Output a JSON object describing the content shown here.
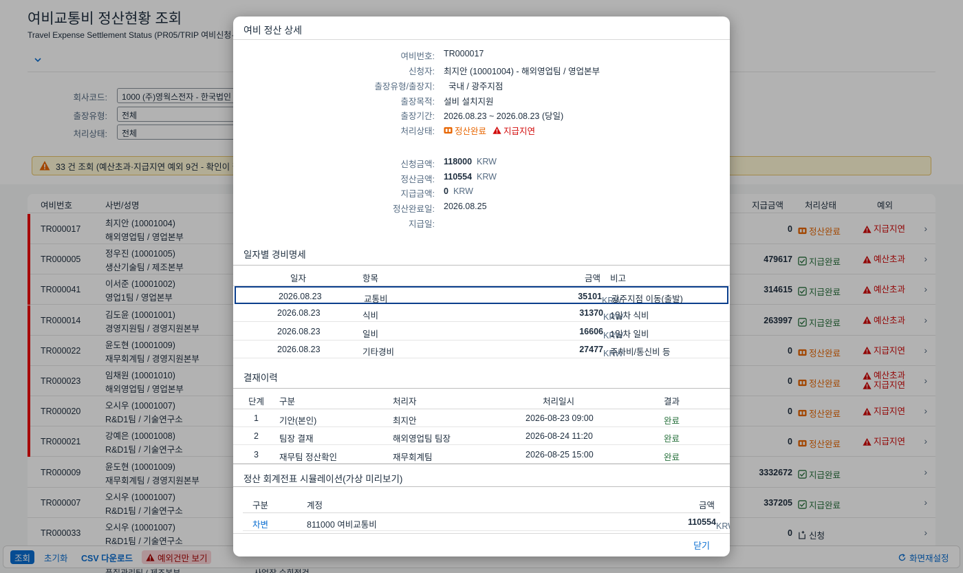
{
  "page": {
    "title": "여비교통비 정산현황 조회",
    "subtitle": "Travel Expense Settlement Status (PR05/TRIP 여비신청·정",
    "filters": [
      {
        "label": "회사코드:",
        "value": "1000 (주)영웍스전자 - 한국법인"
      },
      {
        "label": "출장유형:",
        "value": "전체"
      },
      {
        "label": "처리상태:",
        "value": "전체"
      }
    ],
    "message": "33 건 조회 (예산초과·지급지연 예외 9건 - 확인이 필"
  },
  "table": {
    "headers": {
      "id": "여비번호",
      "name": "사번/성명",
      "amount": "지급금액",
      "status": "처리상태",
      "exception": "예외"
    },
    "rows": [
      {
        "id": "TR000017",
        "name": "최지안 (10001004)",
        "dept": "해외영업팀 / 영업본부",
        "amount": "0",
        "status": "정산완료",
        "status_type": "done",
        "exceptions": [
          "지급지연"
        ],
        "flag": true
      },
      {
        "id": "TR000005",
        "name": "정우진 (10001005)",
        "dept": "생산기술팀 / 제조본부",
        "amount": "479617",
        "status": "지급완료",
        "status_type": "paid",
        "exceptions": [
          "예산초과"
        ],
        "flag": true
      },
      {
        "id": "TR000041",
        "name": "이서준 (10001002)",
        "dept": "영업1팀 / 영업본부",
        "amount": "314615",
        "status": "지급완료",
        "status_type": "paid",
        "exceptions": [
          "예산초과"
        ],
        "flag": true
      },
      {
        "id": "TR000014",
        "name": "김도윤 (10001001)",
        "dept": "경영지원팀 / 경영지원본부",
        "amount": "263997",
        "status": "지급완료",
        "status_type": "paid",
        "exceptions": [
          "예산초과"
        ],
        "flag": true
      },
      {
        "id": "TR000022",
        "name": "윤도현 (10001009)",
        "dept": "재무회계팀 / 경영지원본부",
        "amount": "0",
        "status": "정산완료",
        "status_type": "done",
        "exceptions": [
          "지급지연"
        ],
        "flag": true
      },
      {
        "id": "TR000023",
        "name": "임채원 (10001010)",
        "dept": "해외영업팀 / 영업본부",
        "amount": "0",
        "status": "정산완료",
        "status_type": "done",
        "exceptions": [
          "예산초과",
          "지급지연"
        ],
        "flag": true
      },
      {
        "id": "TR000020",
        "name": "오시우 (10001007)",
        "dept": "R&D1팀 / 기술연구소",
        "amount": "0",
        "status": "정산완료",
        "status_type": "done",
        "exceptions": [
          "지급지연"
        ],
        "flag": true
      },
      {
        "id": "TR000021",
        "name": "강예은 (10001008)",
        "dept": "R&D1팀 / 기술연구소",
        "amount": "0",
        "status": "정산완료",
        "status_type": "done",
        "exceptions": [
          "지급지연"
        ],
        "flag": true
      },
      {
        "id": "TR000009",
        "name": "윤도현 (10001009)",
        "dept": "재무회계팀 / 경영지원본부",
        "amount": "3332672",
        "status": "지급완료",
        "status_type": "paid",
        "exceptions": [],
        "flag": false
      },
      {
        "id": "TR000007",
        "name": "오시우 (10001007)",
        "dept": "R&D1팀 / 기술연구소",
        "amount": "337205",
        "status": "지급완료",
        "status_type": "paid",
        "exceptions": [],
        "flag": false
      },
      {
        "id": "TR000033",
        "name": "오시우 (10001007)",
        "dept": "R&D1팀 / 기술연구소",
        "amount": "0",
        "status": "신청",
        "status_type": "apply",
        "exceptions": [],
        "flag": false
      }
    ],
    "partial_row": {
      "dept": "품질관리팀 / 제조본부",
      "extra": "사업장 순회점검"
    }
  },
  "footer": {
    "search": "조회",
    "reset": "초기화",
    "csv": "CSV 다운로드",
    "exceptions_only": "예외건만 보기",
    "layout": "화면재설정"
  },
  "dialog": {
    "title": "여비 정산 상세",
    "fields": [
      {
        "label": "여비번호:",
        "value": "TR000017"
      },
      {
        "label": "신청자:",
        "value": "최지안 (10001004) - 해외영업팀 / 영업본부"
      },
      {
        "label": "출장유형/출장지:",
        "value": "  국내 / 광주지점"
      },
      {
        "label": "출장목적:",
        "value": "설비 설치지원"
      },
      {
        "label": "출장기간:",
        "value": "2026.08.23 ~ 2026.08.23 (당일)"
      }
    ],
    "status_label": "처리상태:",
    "status_value": "정산완료",
    "status_exception": "지급지연",
    "amounts": [
      {
        "label": "신청금액:",
        "value": "118000",
        "unit": "KRW"
      },
      {
        "label": "정산금액:",
        "value": "110554",
        "unit": "KRW"
      },
      {
        "label": "지급금액:",
        "value": "0",
        "unit": "KRW"
      }
    ],
    "settle_date_label": "정산완료일:",
    "settle_date": "2026.08.25",
    "pay_date_label": "지급일:",
    "pay_date": "",
    "daily": {
      "title": "일자별 경비명세",
      "headers": {
        "date": "일자",
        "item": "항목",
        "amount": "금액",
        "note": "비고"
      },
      "rows": [
        {
          "date": "2026.08.23",
          "item": "교통비",
          "amount": "35101",
          "unit": "KRW",
          "note": "광주지점 이동(출발)"
        },
        {
          "date": "2026.08.23",
          "item": "식비",
          "amount": "31370",
          "unit": "KRW",
          "note": "1일차 식비"
        },
        {
          "date": "2026.08.23",
          "item": "일비",
          "amount": "16606",
          "unit": "KRW",
          "note": "1일차 일비"
        },
        {
          "date": "2026.08.23",
          "item": "기타경비",
          "amount": "27477",
          "unit": "KRW",
          "note": "주차비/통신비 등"
        }
      ]
    },
    "approval": {
      "title": "결재이력",
      "headers": {
        "step": "단계",
        "type": "구분",
        "actor": "처리자",
        "time": "처리일시",
        "result": "결과"
      },
      "rows": [
        {
          "step": "1",
          "type": "기안(본인)",
          "actor": "최지안",
          "time": "2026-08-23 09:00",
          "result": "완료"
        },
        {
          "step": "2",
          "type": "팀장 결재",
          "actor": "해외영업팀 팀장",
          "time": "2026-08-24 11:20",
          "result": "완료"
        },
        {
          "step": "3",
          "type": "재무팀 정산확인",
          "actor": "재무회계팀",
          "time": "2026-08-25 15:00",
          "result": "완료"
        }
      ]
    },
    "journal": {
      "title": "정산 회계전표 시뮬레이션(가상 미리보기)",
      "headers": {
        "type": "구분",
        "account": "계정",
        "amount": "금액"
      },
      "rows": [
        {
          "type": "차변",
          "account": "811000 여비교통비",
          "amount": "110554",
          "unit": "KRW"
        }
      ]
    },
    "close": "닫기"
  },
  "colors": {
    "accent": "#0a6ed1",
    "error": "#d20a0a",
    "success": "#256f3a",
    "warning": "#e76500"
  }
}
